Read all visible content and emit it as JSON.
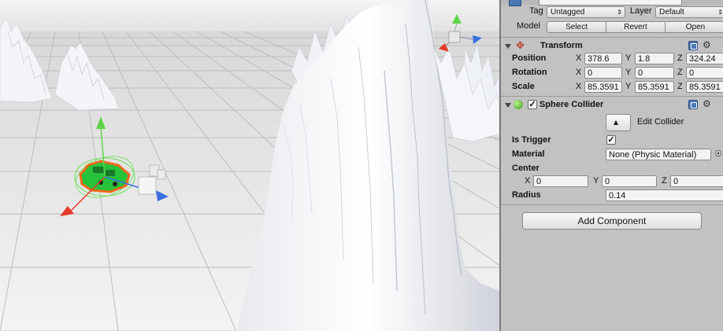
{
  "inspector": {
    "tag_label": "Tag",
    "tag_value": "Untagged",
    "layer_label": "Layer",
    "layer_value": "Default",
    "model_label": "Model",
    "model_buttons": [
      "Select",
      "Revert",
      "Open"
    ],
    "transform": {
      "title": "Transform",
      "position_label": "Position",
      "rotation_label": "Rotation",
      "scale_label": "Scale",
      "position": {
        "x": "378.6",
        "y": "1.8",
        "z": "324.24"
      },
      "rotation": {
        "x": "0",
        "y": "0",
        "z": "0"
      },
      "scale": {
        "x": "85.3591",
        "y": "85.3591",
        "z": "85.3591"
      }
    },
    "sphere_collider": {
      "title": "Sphere Collider",
      "edit_collider_label": "Edit Collider",
      "is_trigger_label": "Is Trigger",
      "is_trigger": true,
      "material_label": "Material",
      "material_value": "None (Physic Material)",
      "center_label": "Center",
      "center": {
        "x": "0",
        "y": "0",
        "z": "0"
      },
      "radius_label": "Radius",
      "radius_value": "0.14"
    },
    "add_component_label": "Add Component",
    "axis_labels": {
      "x": "X",
      "y": "Y",
      "z": "Z"
    }
  },
  "colors": {
    "inspector_bg": "#c2c2c2",
    "field_bg": "#f3f3f3",
    "gizmo_x": "#e53a2a",
    "gizmo_y": "#5fd44a",
    "gizmo_z": "#3a6fe0",
    "selection_outline": "#f06a1a"
  }
}
